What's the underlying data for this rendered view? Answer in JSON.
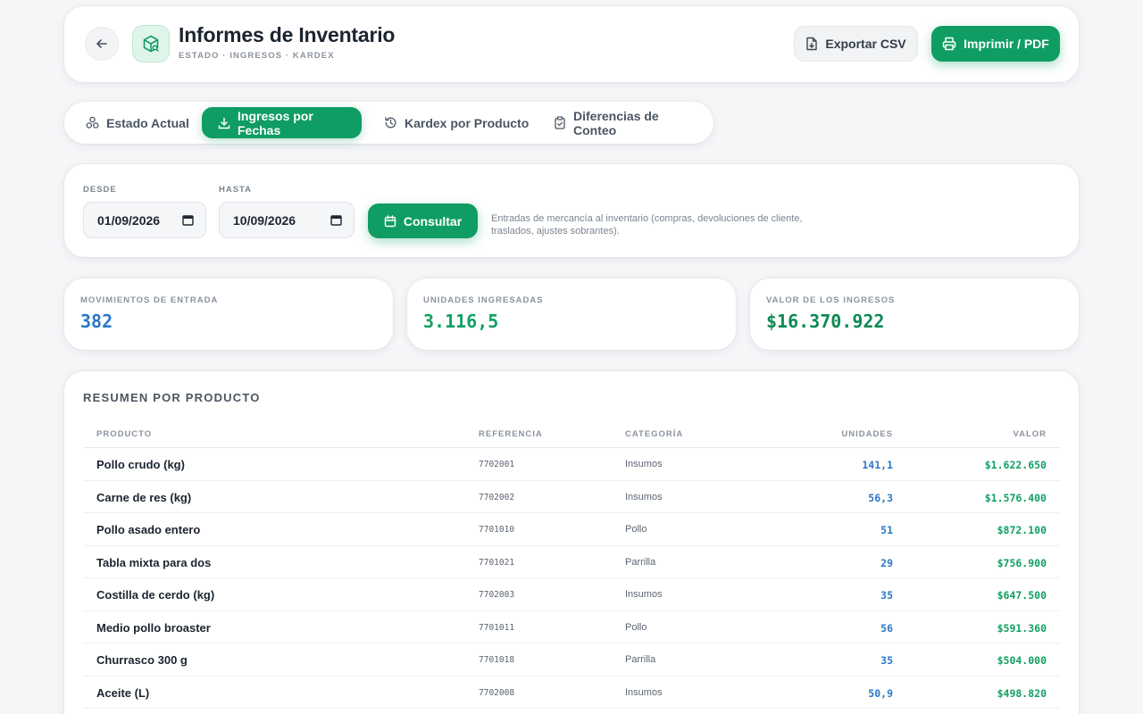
{
  "header": {
    "title": "Informes de Inventario",
    "subtitle": "ESTADO · INGRESOS · KARDEX",
    "export_label": "Exportar CSV",
    "print_label": "Imprimir / PDF"
  },
  "tabs": [
    {
      "label": "Estado Actual",
      "icon": "boxes-icon",
      "active": false
    },
    {
      "label": "Ingresos por Fechas",
      "icon": "download-icon",
      "active": true
    },
    {
      "label": "Kardex por Producto",
      "icon": "history-icon",
      "active": false
    },
    {
      "label": "Diferencias de Conteo",
      "icon": "clipboard-icon",
      "active": false
    }
  ],
  "filters": {
    "from_label": "DESDE",
    "from_value": "01/09/2026",
    "to_label": "HASTA",
    "to_value": "10/09/2026",
    "query_label": "Consultar",
    "note": "Entradas de mercancía al inventario (compras, devoluciones de cliente, traslados, ajustes sobrantes)."
  },
  "kpis": [
    {
      "label": "MOVIMIENTOS DE ENTRADA",
      "value": "382",
      "color": "#2a78c8"
    },
    {
      "label": "UNIDADES INGRESADAS",
      "value": "3.116,5",
      "color": "#10a062"
    },
    {
      "label": "VALOR DE LOS INGRESOS",
      "value": "$16.370.922",
      "color": "#0b8a52"
    }
  ],
  "summary": {
    "title": "RESUMEN POR PRODUCTO",
    "columns": [
      "PRODUCTO",
      "REFERENCIA",
      "CATEGORÍA",
      "UNIDADES",
      "VALOR"
    ],
    "rows": [
      {
        "product": "Pollo crudo (kg)",
        "ref": "7702001",
        "category": "Insumos",
        "units": "141,1",
        "value": "$1.622.650"
      },
      {
        "product": "Carne de res (kg)",
        "ref": "7702002",
        "category": "Insumos",
        "units": "56,3",
        "value": "$1.576.400"
      },
      {
        "product": "Pollo asado entero",
        "ref": "7701010",
        "category": "Pollo",
        "units": "51",
        "value": "$872.100"
      },
      {
        "product": "Tabla mixta para dos",
        "ref": "7701021",
        "category": "Parrilla",
        "units": "29",
        "value": "$756.900"
      },
      {
        "product": "Costilla de cerdo (kg)",
        "ref": "7702003",
        "category": "Insumos",
        "units": "35",
        "value": "$647.500"
      },
      {
        "product": "Medio pollo broaster",
        "ref": "7701011",
        "category": "Pollo",
        "units": "56",
        "value": "$591.360"
      },
      {
        "product": "Churrasco 300 g",
        "ref": "7701018",
        "category": "Parrilla",
        "units": "35",
        "value": "$504.000"
      },
      {
        "product": "Aceite (L)",
        "ref": "7702008",
        "category": "Insumos",
        "units": "50,9",
        "value": "$498.820"
      }
    ]
  }
}
